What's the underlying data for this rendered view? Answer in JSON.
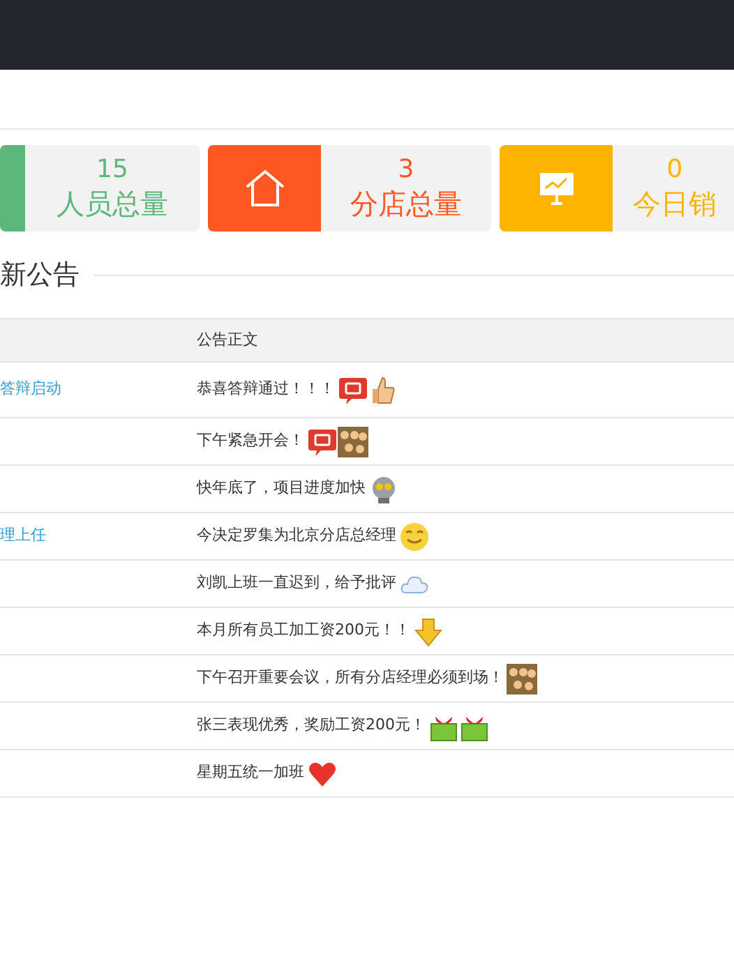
{
  "stats": [
    {
      "number": "15",
      "label": "人员总量",
      "color": "#5cb87a"
    },
    {
      "number": "3",
      "label": "分店总量",
      "color": "#fe5722"
    },
    {
      "number": "0",
      "label": "今日销",
      "color": "#fdb400"
    }
  ],
  "notices": {
    "heading": "新公告",
    "columns": [
      "公告正文"
    ],
    "rows": [
      {
        "title": "答辩启动",
        "body": "恭喜答辩通过！！！",
        "emoticons": [
          {
            "kind": "bubble"
          },
          {
            "kind": "thumb"
          }
        ]
      },
      {
        "title": "",
        "body": "下午紧急开会！",
        "emoticons": [
          {
            "kind": "bubble"
          },
          {
            "kind": "crowd"
          }
        ]
      },
      {
        "title": "",
        "body": "快年底了，项目进度加快",
        "emoticons": [
          {
            "kind": "robot"
          }
        ]
      },
      {
        "title": "理上任",
        "body": "今决定罗集为北京分店总经理",
        "emoticons": [
          {
            "kind": "smile"
          }
        ]
      },
      {
        "title": "",
        "body": "刘凯上班一直迟到，给予批评",
        "emoticons": [
          {
            "kind": "cloud"
          }
        ]
      },
      {
        "title": "",
        "body": "本月所有员工加工资200元！！",
        "emoticons": [
          {
            "kind": "arrow"
          }
        ]
      },
      {
        "title": "",
        "body": "下午召开重要会议，所有分店经理必须到场！",
        "emoticons": [
          {
            "kind": "crowd"
          }
        ]
      },
      {
        "title": "",
        "body": "张三表现优秀，奖励工资200元！",
        "emoticons": [
          {
            "kind": "gift"
          },
          {
            "kind": "gift"
          }
        ]
      },
      {
        "title": "",
        "body": "星期五统一加班",
        "emoticons": [
          {
            "kind": "heart"
          }
        ]
      }
    ]
  }
}
